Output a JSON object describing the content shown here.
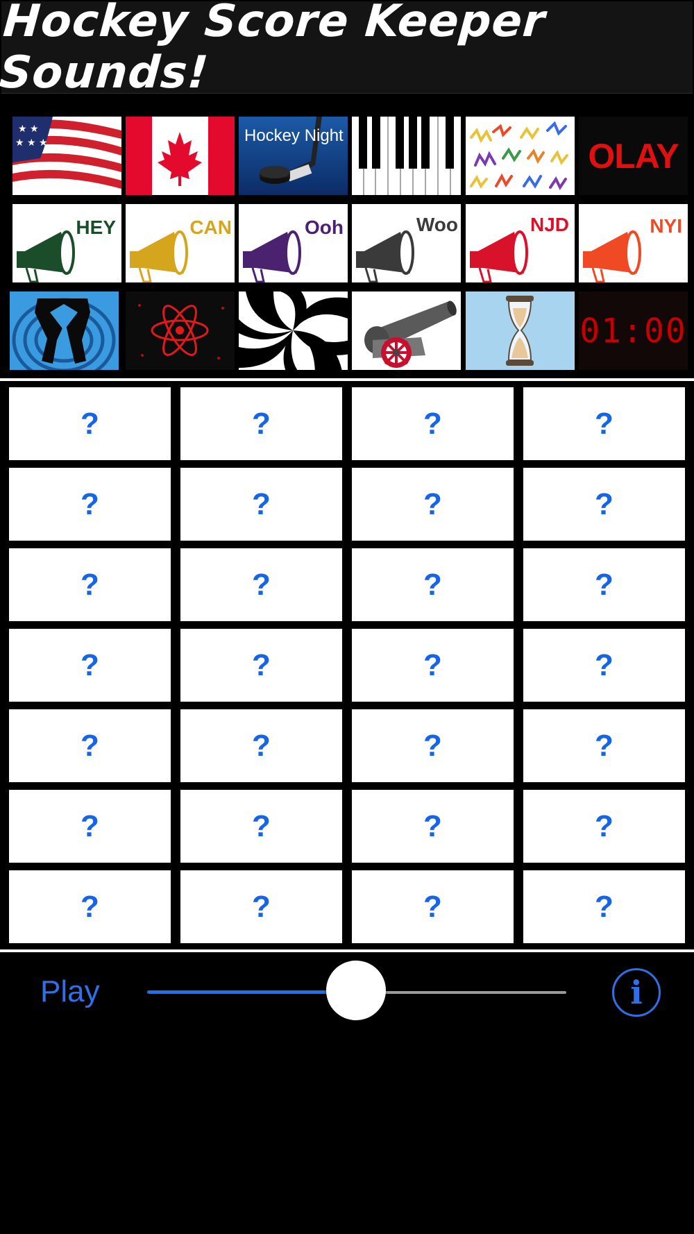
{
  "header": {
    "title": "Hockey Score Keeper Sounds!"
  },
  "tiles": [
    {
      "icon": "usa-flag-icon"
    },
    {
      "icon": "canada-flag-icon"
    },
    {
      "icon": "hockey-night-icon",
      "label": "Hockey Night"
    },
    {
      "icon": "piano-keys-icon"
    },
    {
      "icon": "squiggles-icon"
    },
    {
      "icon": "olay-icon",
      "label": "OLAY"
    },
    {
      "icon": "megaphone-hey-icon",
      "label": "HEY",
      "color": "#1b4d2a"
    },
    {
      "icon": "megaphone-can-icon",
      "label": "CAN",
      "color": "#d6a51e"
    },
    {
      "icon": "megaphone-ooh-icon",
      "label": "Ooh",
      "color": "#4b2270"
    },
    {
      "icon": "megaphone-woo-icon",
      "label": "Woo",
      "color": "#3a3a3a"
    },
    {
      "icon": "megaphone-njd-icon",
      "label": "NJD",
      "color": "#d8122b"
    },
    {
      "icon": "megaphone-nyi-icon",
      "label": "NYI",
      "color": "#ef4a23"
    },
    {
      "icon": "dancing-legs-icon"
    },
    {
      "icon": "atom-icon"
    },
    {
      "icon": "hypno-spiral-icon"
    },
    {
      "icon": "cannon-icon"
    },
    {
      "icon": "hourglass-icon"
    },
    {
      "icon": "clock-display-icon",
      "label": "01:00"
    }
  ],
  "grid": {
    "placeholder": "?",
    "rows": 7,
    "cols": 4
  },
  "controls": {
    "play_label": "Play",
    "volume": 0.5,
    "info_label": "i"
  },
  "colors": {
    "accent": "#2f6fe8",
    "background": "#000000"
  }
}
